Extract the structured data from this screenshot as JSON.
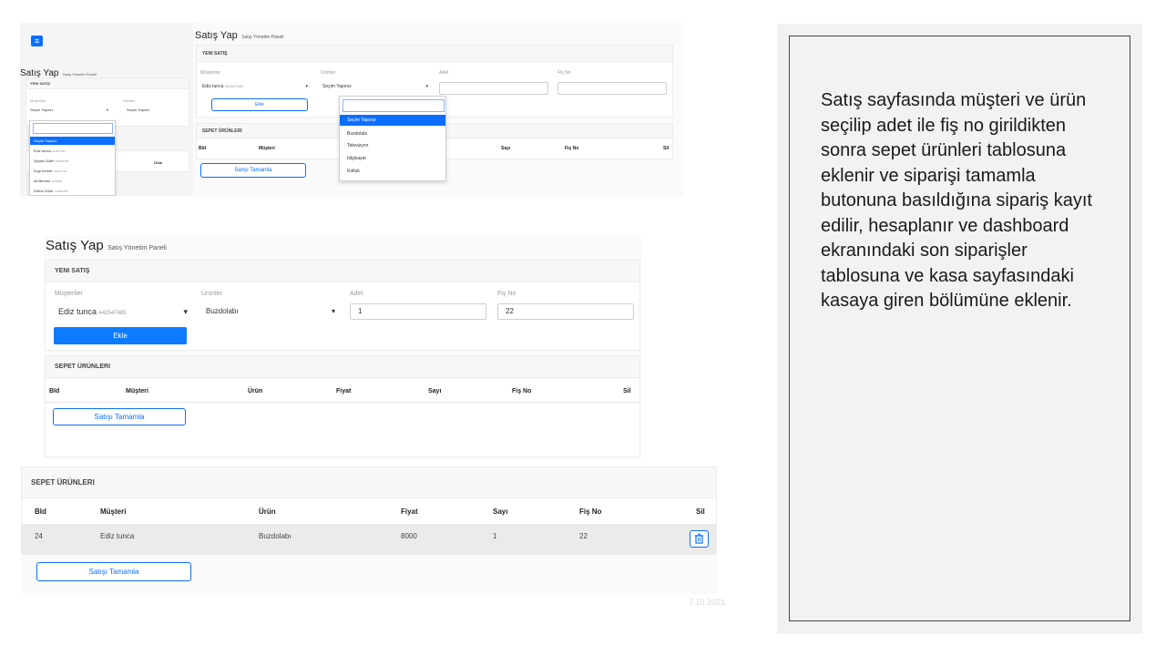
{
  "page": {
    "title": "Satış Yap",
    "subtitle": "Satış Yönetim Paneli"
  },
  "form": {
    "section_title": "YENI SATIŞ",
    "customers_label": "Müşteriler",
    "products_label": "Ürünler",
    "quantity_label": "Adet",
    "receipt_label": "Fiş No",
    "add_button": "Ekle",
    "customer_name": "Ediz tunca",
    "customer_id": "442547485",
    "product_placeholder": "Seçim Yapınız",
    "selected_product": "Buzdolabı",
    "quantity_value": "1",
    "receipt_value": "22"
  },
  "customer_options": [
    {
      "name": "Seçim Yapınız",
      "id": ""
    },
    {
      "name": "Ediz tunca",
      "id": "442547485"
    },
    {
      "name": "Şeyda Güler",
      "id": "408538788"
    },
    {
      "name": "Ezgi Kemer",
      "id": "466847332"
    },
    {
      "name": "Ali Birmen",
      "id": "7158830"
    },
    {
      "name": "Defne Güler",
      "id": "783856485"
    }
  ],
  "product_options": [
    "Seçim Yapınız",
    "Buzdolabı",
    "Televizyon",
    "bilgisayar",
    "Koltuk"
  ],
  "cart": {
    "section_title": "SEPET ÜRÜNLERI",
    "columns": [
      "BId",
      "Müşteri",
      "Ürün",
      "Fiyat",
      "Sayı",
      "Fiş No",
      "Sil"
    ],
    "rows": [
      {
        "bid": "24",
        "customer": "Ediz tunca",
        "product": "Buzdolabı",
        "price": "8000",
        "count": "1",
        "receipt": "22"
      }
    ],
    "complete_button": "Satışı Tamamla"
  },
  "date_stamp": "7.10.2021",
  "description": "Satış sayfasında müşteri ve ürün seçilip adet ile fiş no girildikten sonra sepet ürünleri tablosuna eklenir ve siparişi tamamla butonuna basıldığına sipariş kayıt edilir, hesaplanır ve dashboard ekranındaki son siparişler tablosuna ve kasa sayfasındaki kasaya giren bölümüne eklenir.",
  "colors": {
    "primary": "#0d7bff",
    "panel_bg": "#f2f2f2",
    "panel_border": "#333333"
  }
}
